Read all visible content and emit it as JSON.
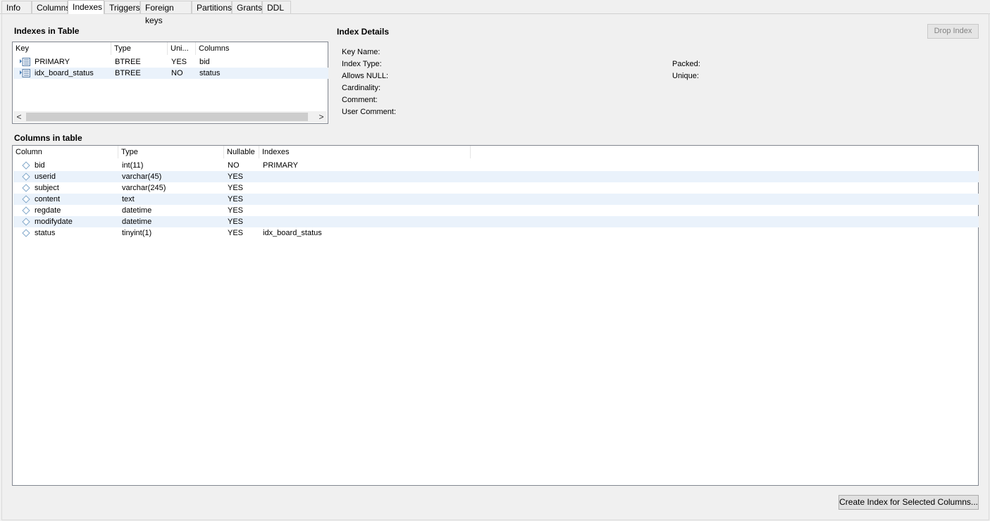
{
  "tabs": [
    "Info",
    "Columns",
    "Indexes",
    "Triggers",
    "Foreign keys",
    "Partitions",
    "Grants",
    "DDL"
  ],
  "active_tab": "Indexes",
  "indexes_panel": {
    "title": "Indexes in Table",
    "headers": [
      "Key",
      "Type",
      "Uni...",
      "Columns"
    ],
    "rows": [
      {
        "key": "PRIMARY",
        "type": "BTREE",
        "unique": "YES",
        "columns": "bid"
      },
      {
        "key": "idx_board_status",
        "type": "BTREE",
        "unique": "NO",
        "columns": "status"
      }
    ],
    "scroll_left": "<",
    "scroll_right": ">"
  },
  "index_details": {
    "title": "Index Details",
    "drop_label": "Drop Index",
    "labels_left": [
      "Key Name:",
      "Index Type:",
      "Allows NULL:",
      "Cardinality:",
      "Comment:",
      "User Comment:"
    ],
    "labels_right": [
      "Packed:",
      "Unique:"
    ]
  },
  "columns_panel": {
    "title": "Columns in table",
    "headers": [
      "Column",
      "Type",
      "Nullable",
      "Indexes"
    ],
    "rows": [
      {
        "column": "bid",
        "type": "int(11)",
        "nullable": "NO",
        "indexes": "PRIMARY"
      },
      {
        "column": "userid",
        "type": "varchar(45)",
        "nullable": "YES",
        "indexes": ""
      },
      {
        "column": "subject",
        "type": "varchar(245)",
        "nullable": "YES",
        "indexes": ""
      },
      {
        "column": "content",
        "type": "text",
        "nullable": "YES",
        "indexes": ""
      },
      {
        "column": "regdate",
        "type": "datetime",
        "nullable": "YES",
        "indexes": ""
      },
      {
        "column": "modifydate",
        "type": "datetime",
        "nullable": "YES",
        "indexes": ""
      },
      {
        "column": "status",
        "type": "tinyint(1)",
        "nullable": "YES",
        "indexes": "idx_board_status"
      }
    ]
  },
  "create_button_label": "Create Index for Selected Columns..."
}
